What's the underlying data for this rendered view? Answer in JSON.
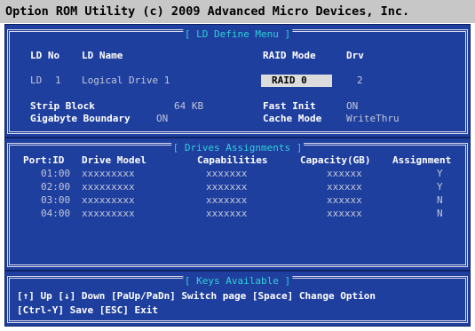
{
  "title": "Option ROM Utility (c) 2009 Advanced Micro Devices, Inc.",
  "ld_define": {
    "legend": "[ LD Define Menu ]",
    "headers": {
      "ld_no": "LD No",
      "ld_name": "LD Name",
      "raid_mode": "RAID Mode",
      "drv": "Drv"
    },
    "row": {
      "ld_prefix": "LD",
      "ld_number": "1",
      "ld_name": "Logical Drive 1",
      "raid_mode": "RAID 0",
      "drv": "2"
    },
    "strip_block": {
      "label": "Strip Block",
      "value": "64 KB"
    },
    "fast_init": {
      "label": "Fast Init",
      "value": "ON"
    },
    "gigabyte_boundary": {
      "label": "Gigabyte Boundary",
      "value": "ON"
    },
    "cache_mode": {
      "label": "Cache Mode",
      "value": "WriteThru"
    }
  },
  "drives": {
    "legend": "[ Drives Assignments ]",
    "headers": {
      "port": "Port:ID",
      "model": "Drive Model",
      "capabilities": "Capabilities",
      "capacity": "Capacity(GB)",
      "assignment": "Assignment"
    },
    "rows": [
      {
        "port": "01:00",
        "model": "xxxxxxxxx",
        "capabilities": "xxxxxxx",
        "capacity": "xxxxxx",
        "assignment": "Y"
      },
      {
        "port": "02:00",
        "model": "xxxxxxxxx",
        "capabilities": "xxxxxxx",
        "capacity": "xxxxxx",
        "assignment": "Y"
      },
      {
        "port": "03:00",
        "model": "xxxxxxxxx",
        "capabilities": "xxxxxxx",
        "capacity": "xxxxxx",
        "assignment": "N"
      },
      {
        "port": "04:00",
        "model": "xxxxxxxxx",
        "capabilities": "xxxxxxx",
        "capacity": "xxxxxx",
        "assignment": "N"
      }
    ]
  },
  "keys": {
    "legend": "[ Keys Available ]",
    "line1": "[↑] Up  [↓] Down  [PaUp/PaDn] Switch page  [Space] Change Option",
    "line2": "[Ctrl-Y] Save  [ESC] Exit"
  },
  "colors": {
    "panel": "#1f3f9e",
    "legend": "#2fd0d8",
    "titlebar": "#c7c7c7",
    "dim_text": "#c0c6d8"
  }
}
